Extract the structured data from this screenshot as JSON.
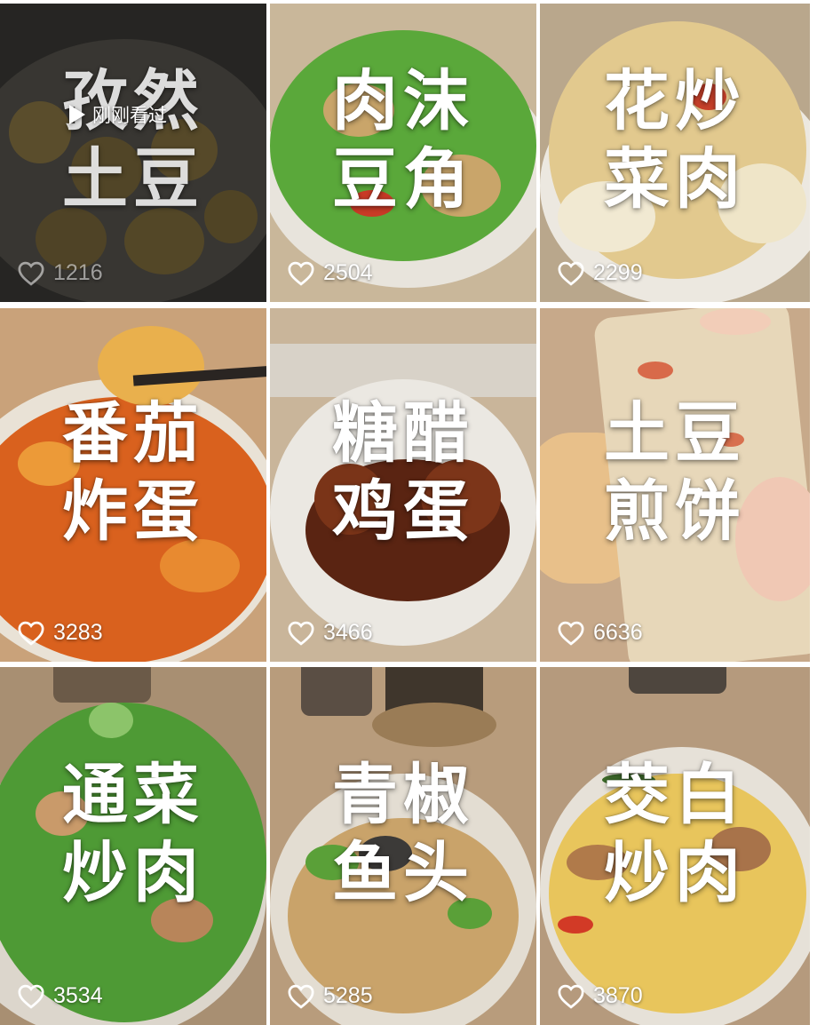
{
  "recent_badge": {
    "label": "刚刚看过",
    "icon": "play-icon"
  },
  "tiles": [
    {
      "title1": "孜然",
      "title2": "土豆",
      "likes": "1216",
      "heart_icon": "heart-outline-icon",
      "bg": "#3b3a36",
      "plate": "#5d5b55",
      "food": "#7a6a3f"
    },
    {
      "title1": "肉沫",
      "title2": "豆角",
      "likes": "2504",
      "heart_icon": "heart-outline-icon",
      "bg": "#c9b79a",
      "plate": "#e8e4dc",
      "food": "#5aa83a"
    },
    {
      "title1": "花炒",
      "title2": "菜肉",
      "likes": "2299",
      "heart_icon": "heart-outline-icon",
      "bg": "#b9a78c",
      "plate": "#ece8e0",
      "food": "#e2c98e"
    },
    {
      "title1": "番茄",
      "title2": "炸蛋",
      "likes": "3283",
      "heart_icon": "heart-outline-icon",
      "bg": "#c9a27a",
      "plate": "#e9e2d6",
      "food": "#d9611e"
    },
    {
      "title1": "糖醋",
      "title2": "鸡蛋",
      "likes": "3466",
      "heart_icon": "heart-outline-icon",
      "bg": "#c9b59a",
      "plate": "#ebe8e2",
      "food": "#5a2412"
    },
    {
      "title1": "土豆",
      "title2": "煎饼",
      "likes": "6636",
      "heart_icon": "heart-outline-icon",
      "bg": "#c7a98a",
      "plate": "#d9c2a0",
      "food": "#e7d7b9"
    },
    {
      "title1": "通菜",
      "title2": "炒肉",
      "likes": "3534",
      "heart_icon": "heart-outline-icon",
      "bg": "#a88f72",
      "plate": "#dcd6cc",
      "food": "#4e9a35"
    },
    {
      "title1": "青椒",
      "title2": "鱼头",
      "likes": "5285",
      "heart_icon": "heart-outline-icon",
      "bg": "#b89c7c",
      "plate": "#e3ddd2",
      "food": "#c9a36a"
    },
    {
      "title1": "茭白",
      "title2": "炒肉",
      "likes": "3870",
      "heart_icon": "heart-outline-icon",
      "bg": "#b59a7d",
      "plate": "#e6e1d8",
      "food": "#e8c55c"
    }
  ]
}
